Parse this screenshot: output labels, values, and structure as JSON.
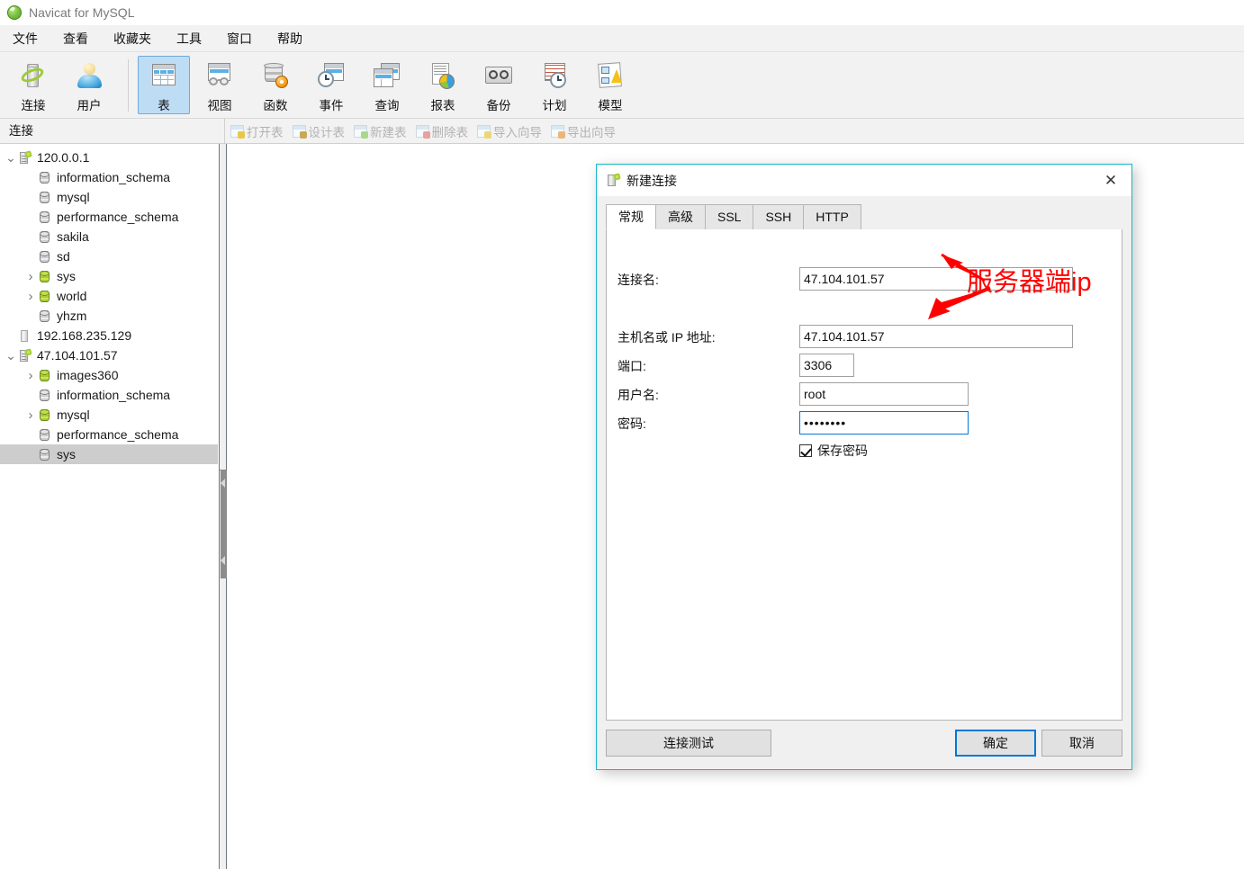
{
  "window": {
    "title": "Navicat for MySQL",
    "app_icon": "navicat-logo-icon"
  },
  "menubar": {
    "items": [
      {
        "label": "文件",
        "name": "menu-file"
      },
      {
        "label": "查看",
        "name": "menu-view"
      },
      {
        "label": "收藏夹",
        "name": "menu-favorites"
      },
      {
        "label": "工具",
        "name": "menu-tools"
      },
      {
        "label": "窗口",
        "name": "menu-window"
      },
      {
        "label": "帮助",
        "name": "menu-help"
      }
    ]
  },
  "toolbar": {
    "items": [
      {
        "label": "连接",
        "icon": "connection-icon",
        "selected": false
      },
      {
        "label": "用户",
        "icon": "user-icon",
        "selected": false
      },
      {
        "label": "表",
        "icon": "table-icon",
        "selected": true
      },
      {
        "label": "视图",
        "icon": "view-icon",
        "selected": false
      },
      {
        "label": "函数",
        "icon": "function-icon",
        "selected": false
      },
      {
        "label": "事件",
        "icon": "event-icon",
        "selected": false
      },
      {
        "label": "查询",
        "icon": "query-icon",
        "selected": false
      },
      {
        "label": "报表",
        "icon": "report-icon",
        "selected": false
      },
      {
        "label": "备份",
        "icon": "backup-icon",
        "selected": false
      },
      {
        "label": "计划",
        "icon": "schedule-icon",
        "selected": false
      },
      {
        "label": "模型",
        "icon": "model-icon",
        "selected": false
      }
    ]
  },
  "subbar": {
    "connection_label": "连接",
    "actions": [
      {
        "label": "打开表",
        "icon": "open-table-icon"
      },
      {
        "label": "设计表",
        "icon": "design-table-icon"
      },
      {
        "label": "新建表",
        "icon": "new-table-icon"
      },
      {
        "label": "删除表",
        "icon": "delete-table-icon"
      },
      {
        "label": "导入向导",
        "icon": "import-wizard-icon"
      },
      {
        "label": "导出向导",
        "icon": "export-wizard-icon"
      }
    ]
  },
  "sidebar": {
    "tree": [
      {
        "label": "120.0.0.1",
        "indent": 0,
        "twisty": "expanded",
        "icon": "server-connected-icon",
        "selected": false
      },
      {
        "label": "information_schema",
        "indent": 1,
        "twisty": "none",
        "icon": "database-grey-icon",
        "selected": false
      },
      {
        "label": "mysql",
        "indent": 1,
        "twisty": "none",
        "icon": "database-grey-icon",
        "selected": false
      },
      {
        "label": "performance_schema",
        "indent": 1,
        "twisty": "none",
        "icon": "database-grey-icon",
        "selected": false
      },
      {
        "label": "sakila",
        "indent": 1,
        "twisty": "none",
        "icon": "database-grey-icon",
        "selected": false
      },
      {
        "label": "sd",
        "indent": 1,
        "twisty": "none",
        "icon": "database-grey-icon",
        "selected": false
      },
      {
        "label": "sys",
        "indent": 1,
        "twisty": "collapsed",
        "icon": "database-green-icon",
        "selected": false
      },
      {
        "label": "world",
        "indent": 1,
        "twisty": "collapsed",
        "icon": "database-green-icon",
        "selected": false
      },
      {
        "label": "yhzm",
        "indent": 1,
        "twisty": "none",
        "icon": "database-grey-icon",
        "selected": false
      },
      {
        "label": "192.168.235.129",
        "indent": 0,
        "twisty": "none",
        "icon": "server-offline-icon",
        "selected": false
      },
      {
        "label": "47.104.101.57",
        "indent": 0,
        "twisty": "expanded",
        "icon": "server-connected-icon",
        "selected": false
      },
      {
        "label": "images360",
        "indent": 1,
        "twisty": "collapsed",
        "icon": "database-green-icon",
        "selected": false
      },
      {
        "label": "information_schema",
        "indent": 1,
        "twisty": "none",
        "icon": "database-grey-icon",
        "selected": false
      },
      {
        "label": "mysql",
        "indent": 1,
        "twisty": "collapsed",
        "icon": "database-green-icon",
        "selected": false
      },
      {
        "label": "performance_schema",
        "indent": 1,
        "twisty": "none",
        "icon": "database-grey-icon",
        "selected": false
      },
      {
        "label": "sys",
        "indent": 1,
        "twisty": "none",
        "icon": "database-grey-icon",
        "selected": true
      }
    ]
  },
  "dialog": {
    "title": "新建连接",
    "close_label": "✕",
    "tabs": [
      {
        "label": "常规",
        "active": true
      },
      {
        "label": "高级",
        "active": false
      },
      {
        "label": "SSL",
        "active": false
      },
      {
        "label": "SSH",
        "active": false
      },
      {
        "label": "HTTP",
        "active": false
      }
    ],
    "fields": [
      {
        "label": "连接名:",
        "value": "47.104.101.57",
        "name": "connection-name",
        "focused": false
      },
      {
        "label": "主机名或 IP 地址:",
        "value": "47.104.101.57",
        "name": "host-ip",
        "focused": false
      },
      {
        "label": "端口:",
        "value": "3306",
        "name": "port",
        "focused": false
      },
      {
        "label": "用户名:",
        "value": "root",
        "name": "username",
        "focused": false
      },
      {
        "label": "密码:",
        "value": "••••••••",
        "name": "password",
        "focused": true
      }
    ],
    "save_password": {
      "label": "保存密码",
      "checked": true
    },
    "buttons": {
      "test": "连接测试",
      "ok": "确定",
      "cancel": "取消"
    }
  },
  "annotation": {
    "text": "服务器端ip",
    "color": "#ff0000"
  }
}
